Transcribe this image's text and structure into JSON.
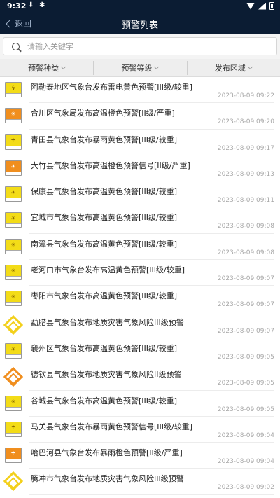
{
  "status": {
    "time": "9:32",
    "icons": [
      "download-icon",
      "notification-icon"
    ]
  },
  "nav": {
    "back_label": "返回",
    "title": "预警列表"
  },
  "search": {
    "placeholder": "请输入关键字"
  },
  "filters": [
    {
      "label": "预警种类"
    },
    {
      "label": "预警等级"
    },
    {
      "label": "发布区域"
    }
  ],
  "colors": {
    "header": "#0b1c33",
    "yellow": "#f3dc18",
    "orange": "#f08e1e"
  },
  "warnings": [
    {
      "icon": "thunder-yellow",
      "title": "阿勒泰地区气象台发布雷电黄色预警[III级/较重]",
      "time": "2023-08-09 09:22"
    },
    {
      "icon": "heat-orange",
      "title": "合川区气象局发布高温橙色预警[II级/严重]",
      "time": "2023-08-09 09:20"
    },
    {
      "icon": "rainstorm-yellow",
      "title": "青田县气象台发布暴雨黄色预警[III级/较重]",
      "time": "2023-08-09 09:17"
    },
    {
      "icon": "heat-orange",
      "title": "大竹县气象台发布高温橙色预警信号[II级/严重]",
      "time": "2023-08-09 09:13"
    },
    {
      "icon": "heat-yellow",
      "title": "保康县气象台发布高温黄色预警[III级/较重]",
      "time": "2023-08-09 09:11"
    },
    {
      "icon": "heat-yellow",
      "title": "宜城市气象台发布高温黄色预警[III级/较重]",
      "time": "2023-08-09 09:08"
    },
    {
      "icon": "heat-yellow",
      "title": "南漳县气象台发布高温黄色预警[III级/较重]",
      "time": "2023-08-09 09:08"
    },
    {
      "icon": "heat-yellow",
      "title": "老河口市气象台发布高温黄色预警[III级/较重]",
      "time": "2023-08-09 09:07"
    },
    {
      "icon": "heat-yellow",
      "title": "枣阳市气象台发布高温黄色预警[III级/较重]",
      "time": "2023-08-09 09:07"
    },
    {
      "icon": "geo-yellow",
      "title": "勐腊县气象台发布地质灾害气象风险III级预警",
      "time": "2023-08-09 09:07"
    },
    {
      "icon": "heat-yellow",
      "title": "襄州区气象台发布高温黄色预警[III级/较重]",
      "time": "2023-08-09 09:05"
    },
    {
      "icon": "geo-orange",
      "title": "德钦县气象台发布地质灾害气象风险II级预警",
      "time": "2023-08-09 09:05"
    },
    {
      "icon": "heat-yellow",
      "title": "谷城县气象台发布高温黄色预警[III级/较重]",
      "time": "2023-08-09 09:05"
    },
    {
      "icon": "rainstorm-yellow",
      "title": "马关县气象台发布暴雨黄色预警信号[III级/较重]",
      "time": "2023-08-09 09:04"
    },
    {
      "icon": "rainstorm-orange",
      "title": "哈巴河县气象台发布暴雨橙色预警[II级/严重]",
      "time": "2023-08-09 09:04"
    },
    {
      "icon": "geo-yellow",
      "title": "腾冲市气象台发布地质灾害气象风险III级预警",
      "time": "2023-08-09 09:02"
    }
  ]
}
